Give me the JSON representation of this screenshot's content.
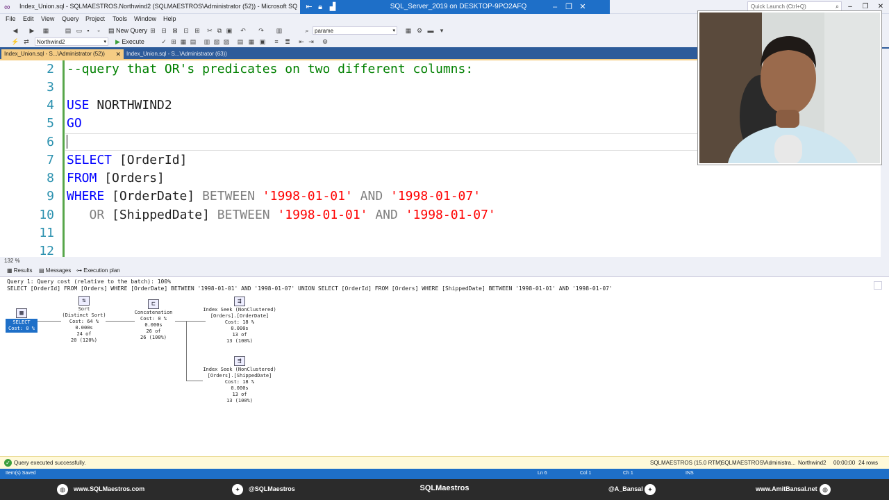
{
  "titlebar": {
    "title": "Index_Union.sql - SQLMAESTROS.Northwind2 (SQLMAESTROS\\Administrator (52)) - Microsoft SQL Server Ma",
    "remote_session": "SQL_Server_2019 on DESKTOP-9PO2AFQ",
    "quick_launch_placeholder": "Quick Launch (Ctrl+Q)"
  },
  "menu": [
    "File",
    "Edit",
    "View",
    "Query",
    "Project",
    "Tools",
    "Window",
    "Help"
  ],
  "toolbar": {
    "new_query_label": "New Query",
    "param_value": "parame",
    "database_value": "Northwind2",
    "execute_label": "Execute"
  },
  "tabs": [
    {
      "label": "Index_Union.sql - S...\\Administrator (52))",
      "active": true
    },
    {
      "label": "Index_Union.sql - S...\\Administrator (63))",
      "active": false
    }
  ],
  "editor": {
    "lines": [
      {
        "num": "2",
        "text": "--query that OR's predicates on two different columns:"
      },
      {
        "num": "3",
        "text": ""
      },
      {
        "num": "4",
        "kw": "USE",
        "rest": " NORTHWIND2"
      },
      {
        "num": "5",
        "kw": "GO",
        "rest": ""
      },
      {
        "num": "6",
        "text": ""
      },
      {
        "num": "7",
        "kw": "SELECT",
        "rest": " [OrderId]"
      },
      {
        "num": "8",
        "kw": "FROM",
        "rest": " [Orders]"
      },
      {
        "num": "9",
        "kw": "WHERE",
        "col": " [OrderDate] ",
        "op": "BETWEEN",
        "s1": " '1998-01-01' ",
        "and": "AND",
        "s2": " '1998-01-07'"
      },
      {
        "num": "10",
        "indent": "   ",
        "or": "OR",
        "col": " [ShippedDate] ",
        "op": "BETWEEN",
        "s1": " '1998-01-01' ",
        "and": "AND",
        "s2": " '1998-01-07'"
      },
      {
        "num": "11",
        "text": ""
      },
      {
        "num": "12",
        "text": ""
      }
    ]
  },
  "zoom_level": "132 %",
  "results_tabs": [
    "Results",
    "Messages",
    "Execution plan"
  ],
  "plan": {
    "header1": "Query 1: Query cost (relative to the batch): 100%",
    "header2": "SELECT [OrderId] FROM [Orders] WHERE [OrderDate] BETWEEN '1998-01-01' AND '1998-01-07' UNION SELECT [OrderId] FROM [Orders] WHERE [ShippedDate] BETWEEN '1998-01-01' AND '1998-01-07'",
    "select": {
      "label": "SELECT",
      "cost": "Cost: 0 %"
    },
    "sort": {
      "l1": "Sort",
      "l2": "(Distinct Sort)",
      "l3": "Cost: 64 %",
      "l4": "0.000s",
      "l5": "24 of",
      "l6": "20 (120%)"
    },
    "concat": {
      "l1": "Concatenation",
      "l2": "Cost: 0 %",
      "l3": "0.000s",
      "l4": "26 of",
      "l5": "26 (100%)"
    },
    "seek1": {
      "l1": "Index Seek (NonClustered)",
      "l2": "[Orders].[OrderDate]",
      "l3": "Cost: 18 %",
      "l4": "0.000s",
      "l5": "13 of",
      "l6": "13 (100%)"
    },
    "seek2": {
      "l1": "Index Seek (NonClustered)",
      "l2": "[Orders].[ShippedDate]",
      "l3": "Cost: 18 %",
      "l4": "0.000s",
      "l5": "13 of",
      "l6": "13 (100%)"
    }
  },
  "status": {
    "message": "Query executed successfully.",
    "server": "SQLMAESTROS (15.0 RTM)",
    "user": "SQLMAESTROS\\Administra...",
    "database": "Northwind2",
    "elapsed": "00:00:00",
    "rows": "24 rows"
  },
  "bottom_status": {
    "saved": "Item(s) Saved",
    "ln": "Ln 6",
    "col": "Col 1",
    "ch": "Ch 1",
    "ins": "INS"
  },
  "footer": {
    "site1": "www.SQLMaestros.com",
    "twitter1": "@SQLMaestros",
    "brand": "SQLMaestros",
    "twitter2": "@A_Bansal",
    "site2": "www.AmitBansal.net"
  },
  "colors": {
    "accent": "#1e6fc8",
    "tab_active": "#f5cc84",
    "keyword": "#0000ff",
    "comment": "#008000",
    "string": "#ff0000",
    "status_bg": "#fff9d9"
  }
}
